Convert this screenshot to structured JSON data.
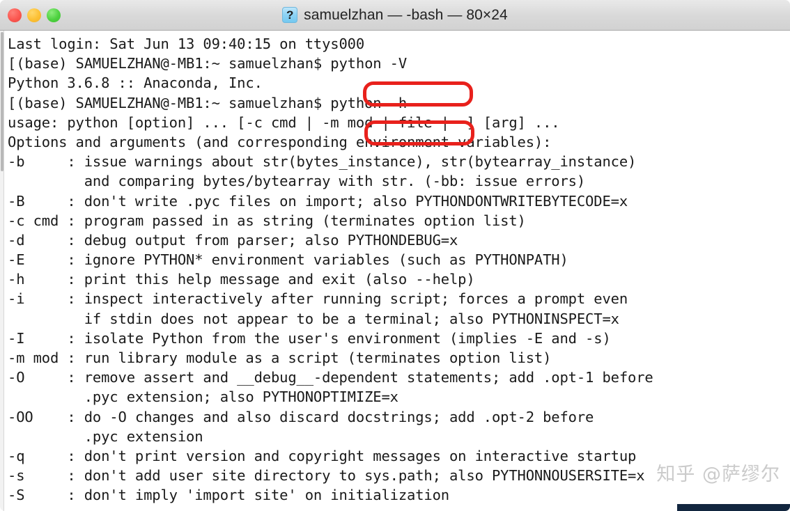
{
  "window": {
    "title": "samuelzhan — -bash — 80×24",
    "icon": "help-question-icon",
    "traffic_lights": [
      {
        "name": "close",
        "color": "#fb5750"
      },
      {
        "name": "minimize",
        "color": "#fcc034"
      },
      {
        "name": "maximize",
        "color": "#4ed140"
      }
    ]
  },
  "terminal": {
    "lines": [
      "Last login: Sat Jun 13 09:40:15 on ttys000",
      "[(base) SAMUELZHAN@-MB1:~ samuelzhan$ python -V",
      "Python 3.6.8 :: Anaconda, Inc.",
      "[(base) SAMUELZHAN@-MB1:~ samuelzhan$ python -h",
      "usage: python [option] ... [-c cmd | -m mod | file | -] [arg] ...",
      "Options and arguments (and corresponding environment variables):",
      "-b     : issue warnings about str(bytes_instance), str(bytearray_instance)",
      "         and comparing bytes/bytearray with str. (-bb: issue errors)",
      "-B     : don't write .pyc files on import; also PYTHONDONTWRITEBYTECODE=x",
      "-c cmd : program passed in as string (terminates option list)",
      "-d     : debug output from parser; also PYTHONDEBUG=x",
      "-E     : ignore PYTHON* environment variables (such as PYTHONPATH)",
      "-h     : print this help message and exit (also --help)",
      "-i     : inspect interactively after running script; forces a prompt even",
      "         if stdin does not appear to be a terminal; also PYTHONINSPECT=x",
      "-I     : isolate Python from the user's environment (implies -E and -s)",
      "-m mod : run library module as a script (terminates option list)",
      "-O     : remove assert and __debug__-dependent statements; add .opt-1 before",
      "         .pyc extension; also PYTHONOPTIMIZE=x",
      "-OO    : do -O changes and also discard docstrings; add .opt-2 before",
      "         .pyc extension",
      "-q     : don't print version and copyright messages on interactive startup",
      "-s     : don't add user site directory to sys.path; also PYTHONNOUSERSITE=x",
      "-S     : don't imply 'import site' on initialization"
    ]
  },
  "annotations": {
    "highlight_color": "#e8211c",
    "boxes": [
      {
        "name": "python-version-command",
        "label": "python -V"
      },
      {
        "name": "python-help-command",
        "label": "python -h"
      }
    ],
    "watermark": "知乎 @萨缪尔"
  }
}
